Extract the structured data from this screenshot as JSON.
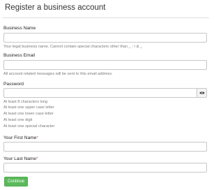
{
  "header": {
    "title": "Register a business account"
  },
  "form": {
    "business_name": {
      "label": "Business Name",
      "value": "",
      "help": "Your legal business name. Cannot contain special characters other than _ - \\ & _"
    },
    "business_email": {
      "label": "Business Email",
      "value": "",
      "help": "All account related messages will be sent to this email address."
    },
    "password": {
      "label": "Password",
      "value": "",
      "toggle_icon": "eye-icon",
      "rules": [
        "At least 8 characters long",
        "At least one upper case letter",
        "At least one lower case letter",
        "At least one digit",
        "At least one special character"
      ]
    },
    "first_name": {
      "label": "Your First Name",
      "required_marker": "*",
      "value": ""
    },
    "last_name": {
      "label": "Your Last Name",
      "required_marker": "*",
      "value": ""
    },
    "submit": {
      "label": "Continue"
    }
  },
  "colors": {
    "primary_button": "#5cb85c",
    "required_marker": "#d9534f",
    "help_text": "#7a7a7a"
  }
}
